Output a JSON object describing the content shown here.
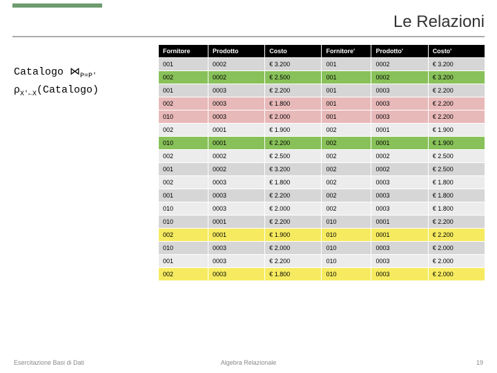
{
  "title": "Le Relazioni",
  "formula": {
    "line1_a": "Catalogo ",
    "line1_join": "⋈",
    "line1_sub": "P=P'",
    "line2_rho": "ρ",
    "line2_sub": "X'←X",
    "line2_b": "(Catalogo)"
  },
  "headers": [
    "Fornitore",
    "Prodotto",
    "Costo",
    "Fornitore'",
    "Prodotto'",
    "Costo'"
  ],
  "rows": [
    {
      "cells": [
        "001",
        "0002",
        "€ 3.200",
        "001",
        "0002",
        "€ 3.200"
      ],
      "hl": ""
    },
    {
      "cells": [
        "002",
        "0002",
        "€ 2.500",
        "001",
        "0002",
        "€ 3.200"
      ],
      "hl": "green"
    },
    {
      "cells": [
        "001",
        "0003",
        "€ 2.200",
        "001",
        "0003",
        "€ 2.200"
      ],
      "hl": ""
    },
    {
      "cells": [
        "002",
        "0003",
        "€ 1.800",
        "001",
        "0003",
        "€ 2.200"
      ],
      "hl": "pink"
    },
    {
      "cells": [
        "010",
        "0003",
        "€ 2.000",
        "001",
        "0003",
        "€ 2.200"
      ],
      "hl": "pink"
    },
    {
      "cells": [
        "002",
        "0001",
        "€ 1.900",
        "002",
        "0001",
        "€ 1.900"
      ],
      "hl": ""
    },
    {
      "cells": [
        "010",
        "0001",
        "€ 2.200",
        "002",
        "0001",
        "€ 1.900"
      ],
      "hl": "green"
    },
    {
      "cells": [
        "002",
        "0002",
        "€ 2.500",
        "002",
        "0002",
        "€ 2.500"
      ],
      "hl": ""
    },
    {
      "cells": [
        "001",
        "0002",
        "€ 3.200",
        "002",
        "0002",
        "€ 2.500"
      ],
      "hl": ""
    },
    {
      "cells": [
        "002",
        "0003",
        "€ 1.800",
        "002",
        "0003",
        "€ 1.800"
      ],
      "hl": ""
    },
    {
      "cells": [
        "001",
        "0003",
        "€ 2.200",
        "002",
        "0003",
        "€ 1.800"
      ],
      "hl": ""
    },
    {
      "cells": [
        "010",
        "0003",
        "€ 2.000",
        "002",
        "0003",
        "€ 1.800"
      ],
      "hl": ""
    },
    {
      "cells": [
        "010",
        "0001",
        "€ 2.200",
        "010",
        "0001",
        "€ 2.200"
      ],
      "hl": ""
    },
    {
      "cells": [
        "002",
        "0001",
        "€ 1.900",
        "010",
        "0001",
        "€ 2.200"
      ],
      "hl": "yellow"
    },
    {
      "cells": [
        "010",
        "0003",
        "€ 2.000",
        "010",
        "0003",
        "€ 2.000"
      ],
      "hl": ""
    },
    {
      "cells": [
        "001",
        "0003",
        "€ 2.200",
        "010",
        "0003",
        "€ 2.000"
      ],
      "hl": ""
    },
    {
      "cells": [
        "002",
        "0003",
        "€ 1.800",
        "010",
        "0003",
        "€ 2.000"
      ],
      "hl": "yellow"
    }
  ],
  "footer": {
    "left": "Esercitazione Basi di Dati",
    "center": "Algebra Relazionale",
    "right": "19"
  }
}
